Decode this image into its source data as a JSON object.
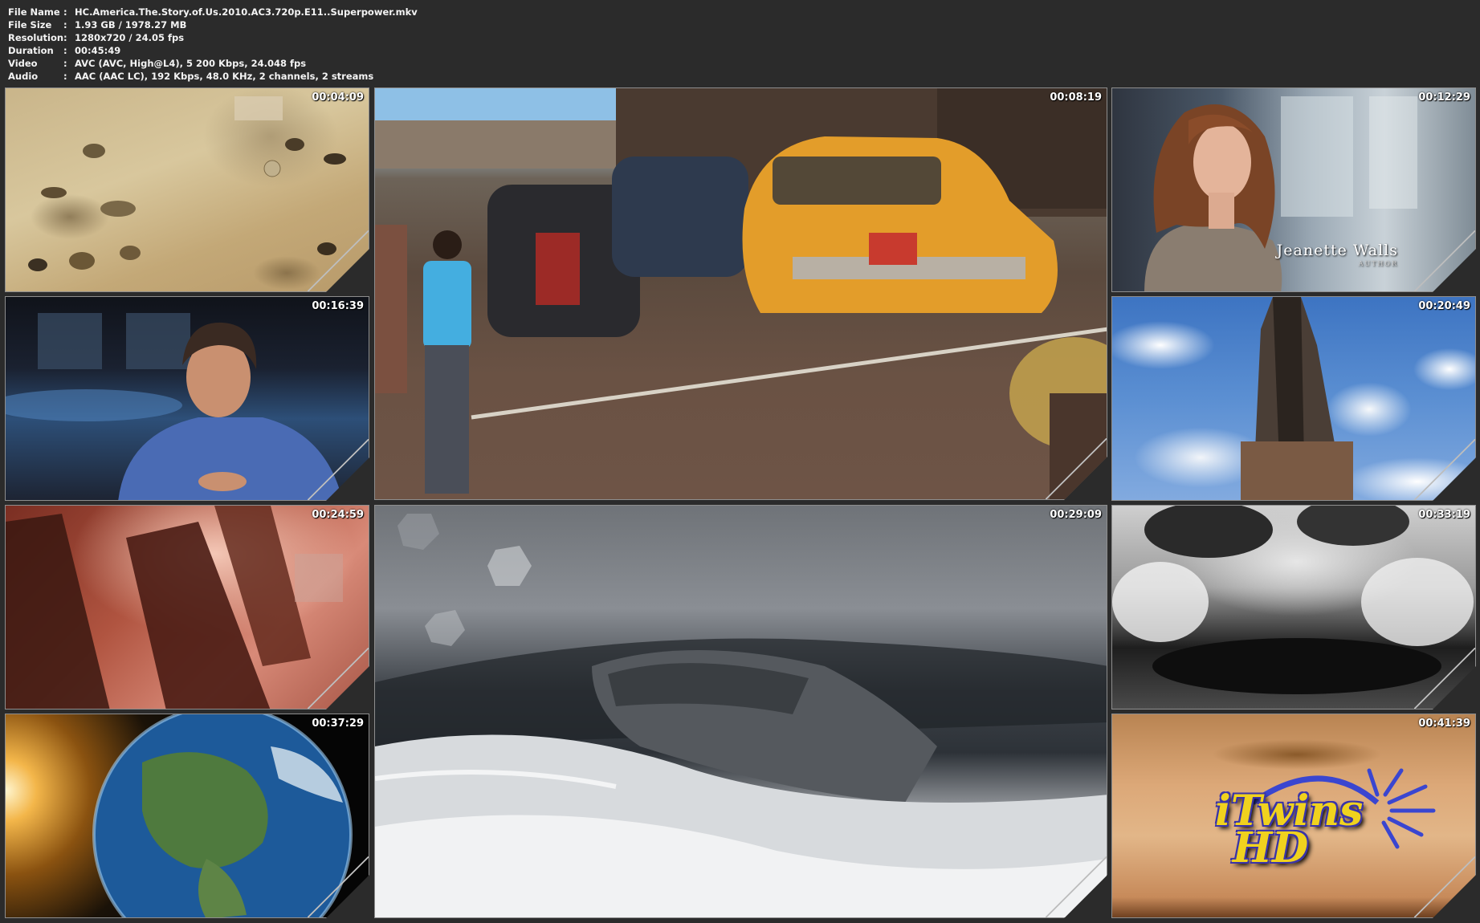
{
  "info": [
    {
      "key": "File Name",
      "value": "HC.America.The.Story.of.Us.2010.AC3.720p.E11..Superpower.mkv"
    },
    {
      "key": "File Size",
      "value": "1.93 GB  / 1978.27 MB"
    },
    {
      "key": "Resolution",
      "value": "1280x720 / 24.05 fps"
    },
    {
      "key": "Duration",
      "value": "00:45:49"
    },
    {
      "key": "Video",
      "value": "AVC (AVC, High@L4), 5 200 Kbps, 24.048 fps"
    },
    {
      "key": "Audio",
      "value": "AAC (AAC LC), 192 Kbps, 48.0 KHz, 2 channels, 2 streams"
    }
  ],
  "separator": ":",
  "thumbnails": [
    {
      "timestamp": "00:04:09",
      "scene": "aerial-dig-site"
    },
    {
      "timestamp": "00:08:19",
      "scene": "street-taxis"
    },
    {
      "timestamp": "00:12:29",
      "scene": "interview-woman",
      "caption_name": "Jeanette Walls",
      "caption_role": "AUTHOR"
    },
    {
      "timestamp": "00:16:39",
      "scene": "interview-man"
    },
    {
      "timestamp": "00:20:49",
      "scene": "skyscraper-sky"
    },
    {
      "timestamp": "00:24:59",
      "scene": "explosion-structure"
    },
    {
      "timestamp": "00:29:09",
      "scene": "boat-storm"
    },
    {
      "timestamp": "00:33:19",
      "scene": "black-white-footage"
    },
    {
      "timestamp": "00:37:29",
      "scene": "earth-sunrise"
    },
    {
      "timestamp": "00:41:39",
      "scene": "logo-card",
      "logo_line1": "iTwins",
      "logo_line2": "HD"
    }
  ],
  "colors": {
    "background": "#2b2b2b",
    "border": "#8e8e8e",
    "text": "#f4f4f4",
    "logo_yellow": "#f0d21e",
    "logo_blue": "#3a34a8"
  }
}
